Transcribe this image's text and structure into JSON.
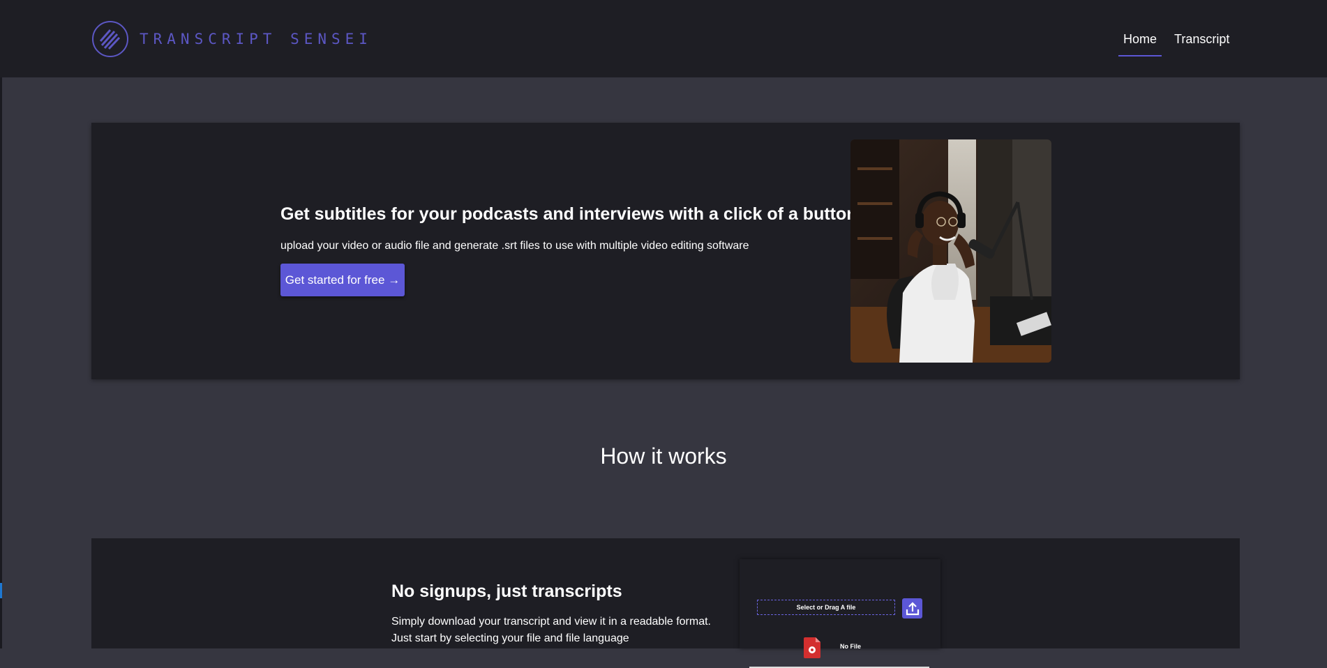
{
  "header": {
    "logo_text": "TRANSCRIPT SENSEI",
    "nav": [
      {
        "label": "Home",
        "active": true
      },
      {
        "label": "Transcript",
        "active": false
      }
    ]
  },
  "hero": {
    "title": "Get subtitles for your podcasts and interviews with a click of a button",
    "subtitle": "upload your video or audio file and generate .srt files to use with multiple video editing software",
    "cta_label": "Get started for free →"
  },
  "how": {
    "title": "How it works"
  },
  "feature": {
    "title": "No signups, just transcripts",
    "lines": [
      "Simply download your transcript and view it in a readable format.",
      "Just start by selecting your file and file language"
    ]
  },
  "upload_widget": {
    "drop_label": "Select or Drag A file",
    "file_status": "No File"
  },
  "colors": {
    "accent": "#5c57d6",
    "page_bg": "#363640",
    "panel_bg": "#1e1e24"
  },
  "icons": [
    "logo-mark-icon",
    "upload-icon",
    "file-icon"
  ]
}
